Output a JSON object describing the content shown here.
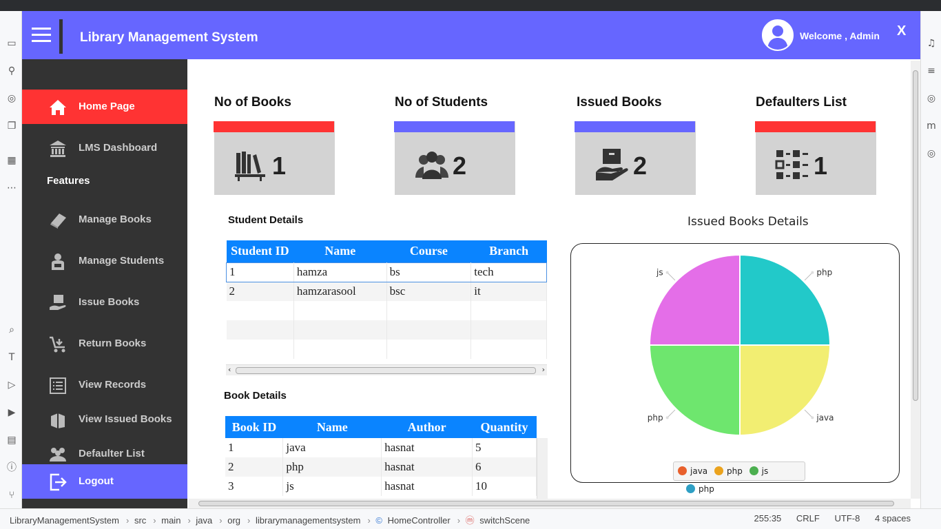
{
  "header": {
    "title": "Library Management System",
    "welcome": "Welcome , Admin",
    "close_label": "X"
  },
  "sidebar": {
    "features_label": "Features",
    "items": [
      {
        "label": "Home Page",
        "icon": "home-icon"
      },
      {
        "label": "LMS Dashboard",
        "icon": "bank-icon"
      },
      {
        "label": "Manage Books",
        "icon": "book-icon"
      },
      {
        "label": "Manage Students",
        "icon": "student-icon"
      },
      {
        "label": "Issue Books",
        "icon": "issue-book-icon"
      },
      {
        "label": "Return Books",
        "icon": "cart-return-icon"
      },
      {
        "label": "View Records",
        "icon": "list-icon"
      },
      {
        "label": "View Issued Books",
        "icon": "books-icon"
      },
      {
        "label": "Defaulter List",
        "icon": "people-group-icon"
      },
      {
        "label": "Logout",
        "icon": "logout-icon"
      }
    ]
  },
  "cards": [
    {
      "title": "No of Books",
      "value": "1",
      "bar_color": "#ff3333",
      "icon": "bookshelf-icon"
    },
    {
      "title": "No of Students",
      "value": "2",
      "bar_color": "#6666ff",
      "icon": "users-icon"
    },
    {
      "title": "Issued Books",
      "value": "2",
      "bar_color": "#6666ff",
      "icon": "book-hand-icon"
    },
    {
      "title": "Defaulters List",
      "value": "1",
      "bar_color": "#ff3333",
      "icon": "checklist-icon"
    }
  ],
  "student_details": {
    "label": "Student Details",
    "columns": [
      "Student ID",
      "Name",
      "Course",
      "Branch"
    ],
    "rows": [
      [
        "1",
        "hamza",
        "bs",
        "tech"
      ],
      [
        "2",
        "hamzarasool",
        "bsc",
        "it"
      ]
    ]
  },
  "book_details": {
    "label": "Book Details",
    "columns": [
      "Book ID",
      "Name",
      "Author",
      "Quantity"
    ],
    "rows": [
      [
        "1",
        "java",
        "hasnat",
        "5"
      ],
      [
        "2",
        "php",
        "hasnat",
        "6"
      ],
      [
        "3",
        "js",
        "hasnat",
        "10"
      ]
    ]
  },
  "chart": {
    "title": "Issued Books Details"
  },
  "chart_data": {
    "type": "pie",
    "title": "Issued Books Details",
    "categories": [
      "java",
      "php",
      "js",
      "php"
    ],
    "values": [
      1,
      1,
      1,
      1
    ],
    "colors": [
      "#f2ee72",
      "#6ee66e",
      "#e46ee8",
      "#22c9c9"
    ],
    "legend": [
      {
        "label": "java",
        "color": "#e8602c"
      },
      {
        "label": "php",
        "color": "#eba31e"
      },
      {
        "label": "js",
        "color": "#4caf50"
      },
      {
        "label": "php",
        "color": "#2e9fc4"
      }
    ],
    "legend_position": "bottom"
  },
  "status_bar": {
    "crumbs": [
      "LibraryManagementSystem",
      "src",
      "main",
      "java",
      "org",
      "librarymanagementsystem",
      "HomeController",
      "switchScene"
    ],
    "position": "255:35",
    "line_ending": "CRLF",
    "encoding": "UTF-8",
    "indent": "4 spaces"
  }
}
